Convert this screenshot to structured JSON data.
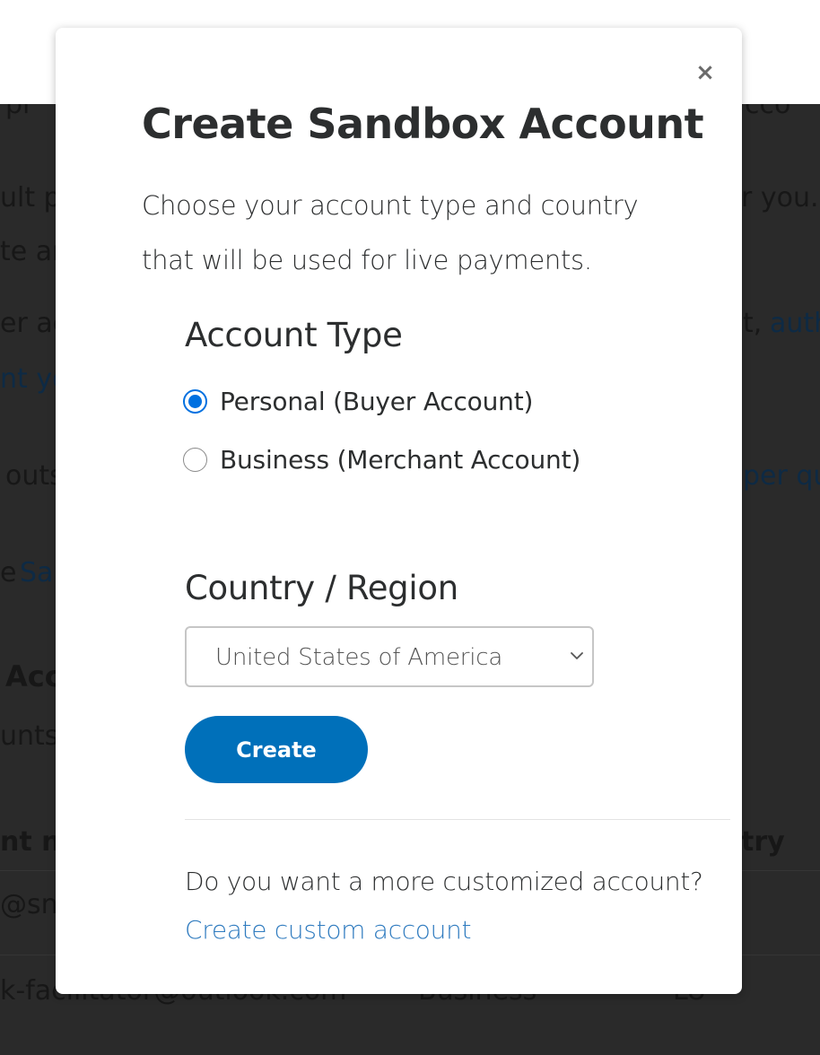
{
  "background": {
    "fragments": {
      "l1_left": "pl",
      "l1_right": "cco",
      "l2_left": "ult p",
      "l2_right": "r you.",
      "l3_left": "te ar",
      "l4_left": "er ac",
      "l4_mid": "t,",
      "l4_link": "auth",
      "l5_link": "nt yo",
      "l6_left": "outs",
      "l6_link": "per qu",
      "l7_left": "e",
      "l7_link": "Sa",
      "h1": "Acc",
      "l8_left": "unts:",
      "th_left": "nt na",
      "th_right": "try",
      "r1_left": "@sn",
      "r2_email": "k-facilitator@outlook.com",
      "r2_type": "Business",
      "r2_country": "LU"
    }
  },
  "modal": {
    "close_label": "×",
    "title": "Create Sandbox Account",
    "description_line1": "Choose your account type and country",
    "description_line2": "that will be used for live payments.",
    "account_type": {
      "label": "Account Type",
      "options": [
        {
          "label": "Personal (Buyer Account)",
          "checked": true
        },
        {
          "label": "Business (Merchant Account)",
          "checked": false
        }
      ]
    },
    "country": {
      "label": "Country / Region",
      "selected": "United States of America"
    },
    "create_label": "Create",
    "custom_question": "Do you want a more customized account?",
    "custom_link": "Create custom account"
  },
  "colors": {
    "accent_button": "#0070ba",
    "radio_checked": "#0070e0",
    "link": "#2f7bbf"
  }
}
